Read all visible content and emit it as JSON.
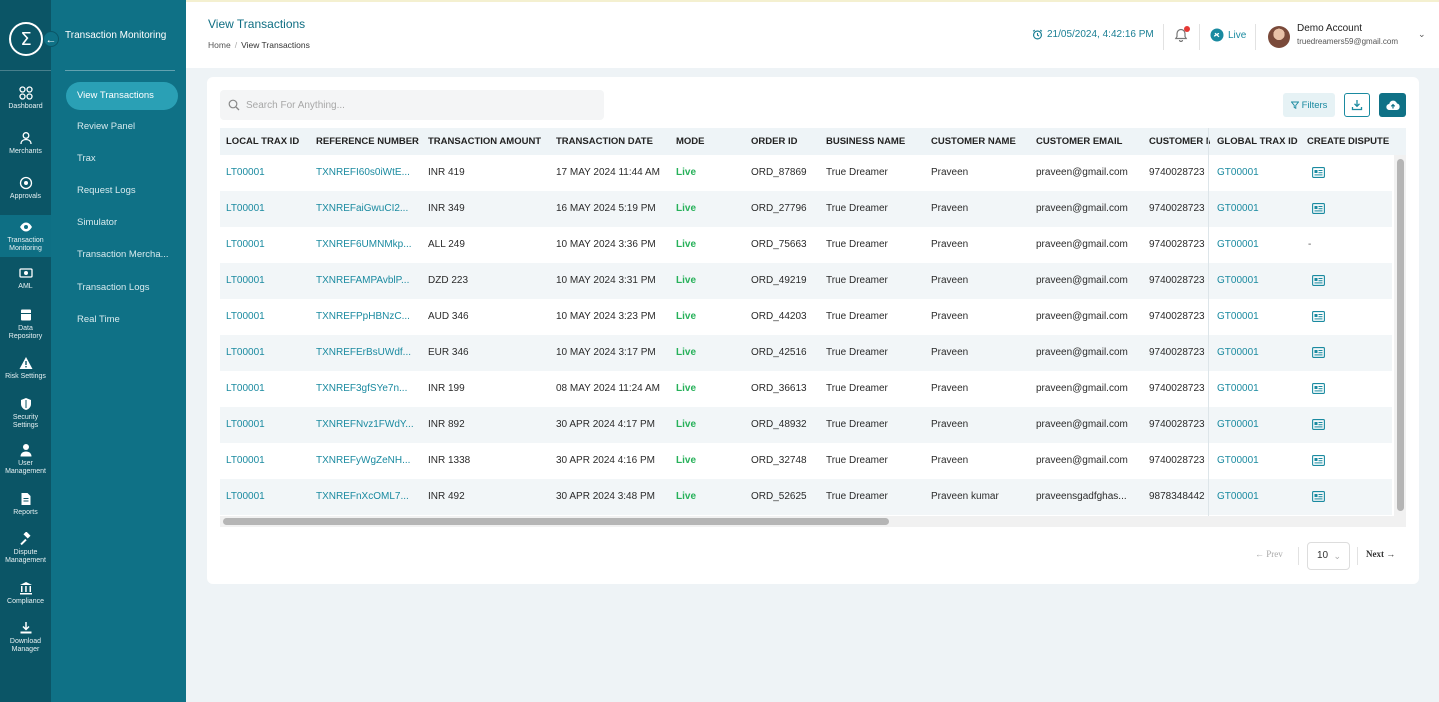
{
  "app": {
    "logo_symbol": "Σ",
    "module_title": "Transaction Monitoring"
  },
  "rail": [
    {
      "label": "Dashboard",
      "icon": "dashboard-icon"
    },
    {
      "label": "Merchants",
      "icon": "user-icon"
    },
    {
      "label": "Approvals",
      "icon": "approvals-icon"
    },
    {
      "label": "Transaction Monitoring",
      "icon": "eye-icon",
      "active": true
    },
    {
      "label": "AML",
      "icon": "aml-icon"
    },
    {
      "label": "Data Repository",
      "icon": "database-icon"
    },
    {
      "label": "Risk Settings",
      "icon": "warning-icon"
    },
    {
      "label": "Security Settings",
      "icon": "shield-icon"
    },
    {
      "label": "User Management",
      "icon": "users-icon"
    },
    {
      "label": "Reports",
      "icon": "report-icon"
    },
    {
      "label": "Dispute Management",
      "icon": "gavel-icon"
    },
    {
      "label": "Compliance",
      "icon": "bank-icon"
    },
    {
      "label": "Download Manager",
      "icon": "download-icon"
    }
  ],
  "submenu": [
    {
      "label": "View Transactions",
      "active": true
    },
    {
      "label": "Review Panel"
    },
    {
      "label": "Trax"
    },
    {
      "label": "Request Logs"
    },
    {
      "label": "Simulator"
    },
    {
      "label": "Transaction Mercha..."
    },
    {
      "label": "Transaction Logs"
    },
    {
      "label": "Real Time"
    }
  ],
  "header": {
    "title": "View Transactions",
    "breadcrumb": [
      "Home",
      "View Transactions"
    ],
    "datetime": "21/05/2024, 4:42:16 PM",
    "mode": "Live",
    "account_name": "Demo Account",
    "account_email": "truedreamers59@gmail.com"
  },
  "toolbar": {
    "search_placeholder": "Search For Anything...",
    "filters_label": "Filters"
  },
  "table": {
    "columns": [
      "LOCAL TRAX ID",
      "REFERENCE NUMBER",
      "TRANSACTION AMOUNT",
      "TRANSACTION DATE",
      "MODE",
      "ORDER ID",
      "BUSINESS NAME",
      "CUSTOMER NAME",
      "CUSTOMER EMAIL",
      "CUSTOMER M",
      "GLOBAL TRAX ID",
      "CREATE DISPUTE"
    ],
    "rows": [
      {
        "local": "LT00001",
        "ref": "TXNREFI60s0iWtE...",
        "amount": "INR 419",
        "date": "17 MAY 2024 11:44 AM",
        "mode": "Live",
        "order": "ORD_87869",
        "business": "True Dreamer",
        "customer": "Praveen",
        "email": "praveen@gmail.com",
        "mobile": "9740028723",
        "global": "GT00001",
        "dispute": "icon"
      },
      {
        "local": "LT00001",
        "ref": "TXNREFaiGwuCI2...",
        "amount": "INR 349",
        "date": "16 MAY 2024 5:19 PM",
        "mode": "Live",
        "order": "ORD_27796",
        "business": "True Dreamer",
        "customer": "Praveen",
        "email": "praveen@gmail.com",
        "mobile": "9740028723",
        "global": "GT00001",
        "dispute": "icon"
      },
      {
        "local": "LT00001",
        "ref": "TXNREF6UMNMkp...",
        "amount": "ALL 249",
        "date": "10 MAY 2024 3:36 PM",
        "mode": "Live",
        "order": "ORD_75663",
        "business": "True Dreamer",
        "customer": "Praveen",
        "email": "praveen@gmail.com",
        "mobile": "9740028723",
        "global": "GT00001",
        "dispute": "-"
      },
      {
        "local": "LT00001",
        "ref": "TXNREFAMPAvblP...",
        "amount": "DZD 223",
        "date": "10 MAY 2024 3:31 PM",
        "mode": "Live",
        "order": "ORD_49219",
        "business": "True Dreamer",
        "customer": "Praveen",
        "email": "praveen@gmail.com",
        "mobile": "9740028723",
        "global": "GT00001",
        "dispute": "icon"
      },
      {
        "local": "LT00001",
        "ref": "TXNREFPpHBNzC...",
        "amount": "AUD 346",
        "date": "10 MAY 2024 3:23 PM",
        "mode": "Live",
        "order": "ORD_44203",
        "business": "True Dreamer",
        "customer": "Praveen",
        "email": "praveen@gmail.com",
        "mobile": "9740028723",
        "global": "GT00001",
        "dispute": "icon"
      },
      {
        "local": "LT00001",
        "ref": "TXNREFErBsUWdf...",
        "amount": "EUR 346",
        "date": "10 MAY 2024 3:17 PM",
        "mode": "Live",
        "order": "ORD_42516",
        "business": "True Dreamer",
        "customer": "Praveen",
        "email": "praveen@gmail.com",
        "mobile": "9740028723",
        "global": "GT00001",
        "dispute": "icon"
      },
      {
        "local": "LT00001",
        "ref": "TXNREF3gfSYe7n...",
        "amount": "INR 199",
        "date": "08 MAY 2024 11:24 AM",
        "mode": "Live",
        "order": "ORD_36613",
        "business": "True Dreamer",
        "customer": "Praveen",
        "email": "praveen@gmail.com",
        "mobile": "9740028723",
        "global": "GT00001",
        "dispute": "icon"
      },
      {
        "local": "LT00001",
        "ref": "TXNREFNvz1FWdY...",
        "amount": "INR 892",
        "date": "30 APR 2024 4:17 PM",
        "mode": "Live",
        "order": "ORD_48932",
        "business": "True Dreamer",
        "customer": "Praveen",
        "email": "praveen@gmail.com",
        "mobile": "9740028723",
        "global": "GT00001",
        "dispute": "icon"
      },
      {
        "local": "LT00001",
        "ref": "TXNREFyWgZeNH...",
        "amount": "INR 1338",
        "date": "30 APR 2024 4:16 PM",
        "mode": "Live",
        "order": "ORD_32748",
        "business": "True Dreamer",
        "customer": "Praveen",
        "email": "praveen@gmail.com",
        "mobile": "9740028723",
        "global": "GT00001",
        "dispute": "icon"
      },
      {
        "local": "LT00001",
        "ref": "TXNREFnXcOML7...",
        "amount": "INR 492",
        "date": "30 APR 2024 3:48 PM",
        "mode": "Live",
        "order": "ORD_52625",
        "business": "True Dreamer",
        "customer": "Praveen kumar",
        "email": "praveensgadfghas...",
        "mobile": "9878348442",
        "global": "GT00001",
        "dispute": "icon"
      }
    ]
  },
  "pagination": {
    "prev_label": "Prev",
    "page_size": "10",
    "next_label": "Next"
  },
  "colors": {
    "rail": "#0b5566",
    "sidebar": "#0f7186",
    "accent": "#1a8aa0",
    "live": "#27b15a"
  }
}
